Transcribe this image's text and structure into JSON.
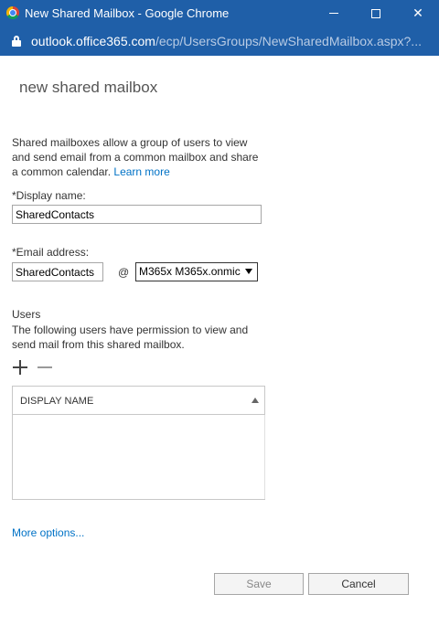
{
  "window": {
    "title": "New Shared Mailbox - Google Chrome",
    "minimize": "",
    "maximize": "",
    "close": "✕"
  },
  "address_bar": {
    "host": "outlook.office365.com",
    "path": "/ecp/UsersGroups/NewSharedMailbox.aspx?..."
  },
  "page": {
    "title": "new shared mailbox",
    "intro": "Shared mailboxes allow a group of users to view and send email from a common mailbox and share a common calendar.",
    "learn_more": "Learn more"
  },
  "form": {
    "display_name_label": "*Display name:",
    "display_name_value": "SharedContacts",
    "email_label": "*Email address:",
    "email_value": "SharedContacts",
    "at_sign": "@",
    "domain_selected": "M365x M365x.onmic"
  },
  "users": {
    "label": "Users",
    "description": "The following users have permission to view and send mail from this shared mailbox.",
    "column_header": "DISPLAY NAME",
    "rows": []
  },
  "more_options": "More options...",
  "buttons": {
    "save": "Save",
    "cancel": "Cancel"
  },
  "colors": {
    "titlebar": "#1f5fa8",
    "link": "#0072c6"
  },
  "icons": [
    "chrome-icon",
    "lock-icon",
    "plus-icon",
    "minus-icon",
    "sort-ascending-icon"
  ]
}
